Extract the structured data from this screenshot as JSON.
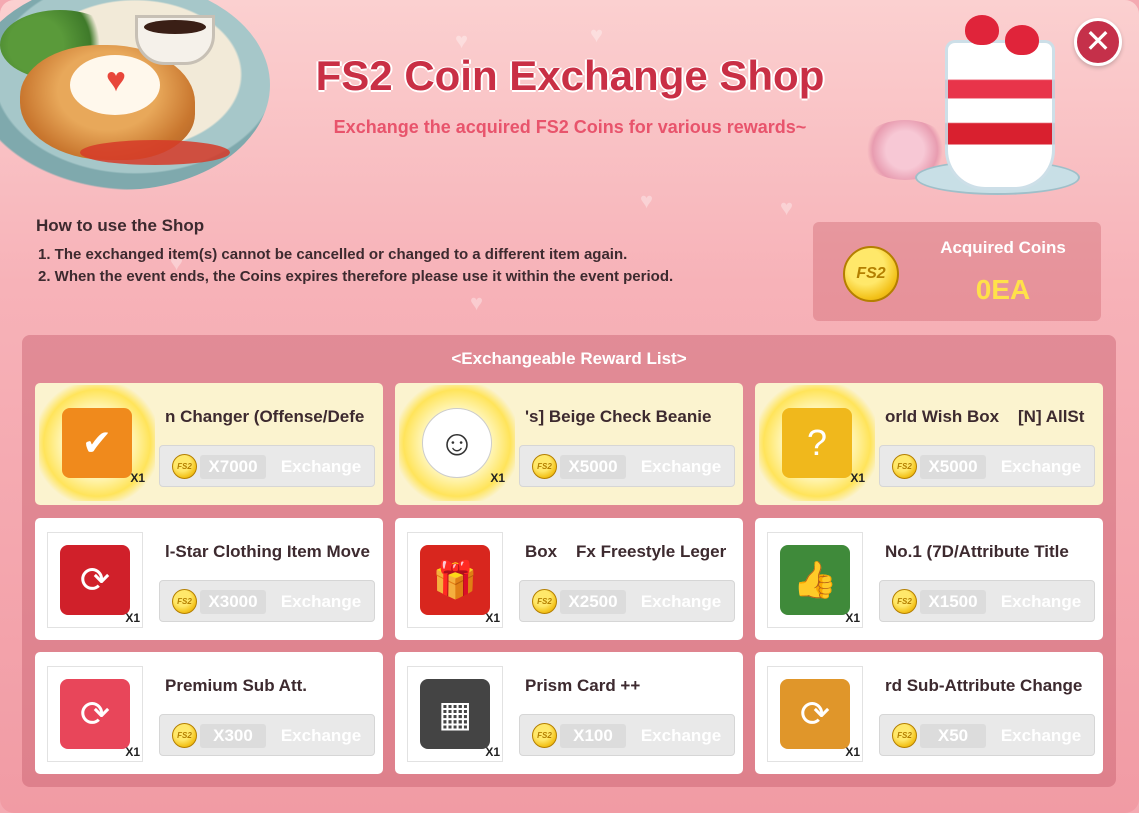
{
  "header": {
    "title": "FS2 Coin Exchange Shop",
    "subtitle": "Exchange the acquired FS2 Coins for various rewards~"
  },
  "howto": {
    "title": "How to use the Shop",
    "lines": [
      "1. The exchanged item(s) cannot be cancelled or changed to a different item again.",
      "2. When the event ends, the Coins expires therefore please use it within the event period."
    ]
  },
  "coins": {
    "label": "Acquired Coins",
    "value": "0EA",
    "coin_text": "FS2"
  },
  "rewards": {
    "title": "<Exchangeable Reward List>",
    "button_label": "Exchange",
    "items": [
      {
        "name": "n Changer (Offense/Defe",
        "qty": "X1",
        "price": "X7000",
        "icon": "skill-changer-card-icon",
        "highlight": true,
        "color": "#f08a1c"
      },
      {
        "name": "'s] Beige Check Beanie",
        "qty": "X1",
        "price": "X5000",
        "icon": "beanie-avatar-icon",
        "highlight": true,
        "color": "#ffffff"
      },
      {
        "name": "orld Wish Box    [N] AllSt",
        "qty": "X1",
        "price": "X5000",
        "icon": "wish-box-icon",
        "highlight": true,
        "color": "#f0b81c"
      },
      {
        "name": "l-Star Clothing Item Move",
        "qty": "X1",
        "price": "X3000",
        "icon": "clothing-move-icon",
        "highlight": false,
        "color": "#d0202a"
      },
      {
        "name": "Box    Fx Freestyle Leger",
        "qty": "X1",
        "price": "X2500",
        "icon": "freestyle-box-icon",
        "highlight": false,
        "color": "#d8261e"
      },
      {
        "name": "No.1 (7D/Attribute Title",
        "qty": "X1",
        "price": "X1500",
        "icon": "thumbs-up-title-icon",
        "highlight": false,
        "color": "#3f8a3a"
      },
      {
        "name": "Premium Sub Att.",
        "qty": "X1",
        "price": "X300",
        "icon": "sub-attribute-card-icon",
        "highlight": false,
        "color": "#e8465a"
      },
      {
        "name": "Prism Card ++",
        "qty": "X1",
        "price": "X100",
        "icon": "prism-card-icon",
        "highlight": false,
        "color": "#444444"
      },
      {
        "name": "rd Sub-Attribute Change",
        "qty": "X1",
        "price": "X50",
        "icon": "sub-attribute-change-icon",
        "highlight": false,
        "color": "#e0962a"
      }
    ]
  },
  "colors": {
    "title": "#c92f45",
    "subtitle": "#e8546c",
    "coin_value": "#ffe14a",
    "close_button": "#c5304a"
  }
}
